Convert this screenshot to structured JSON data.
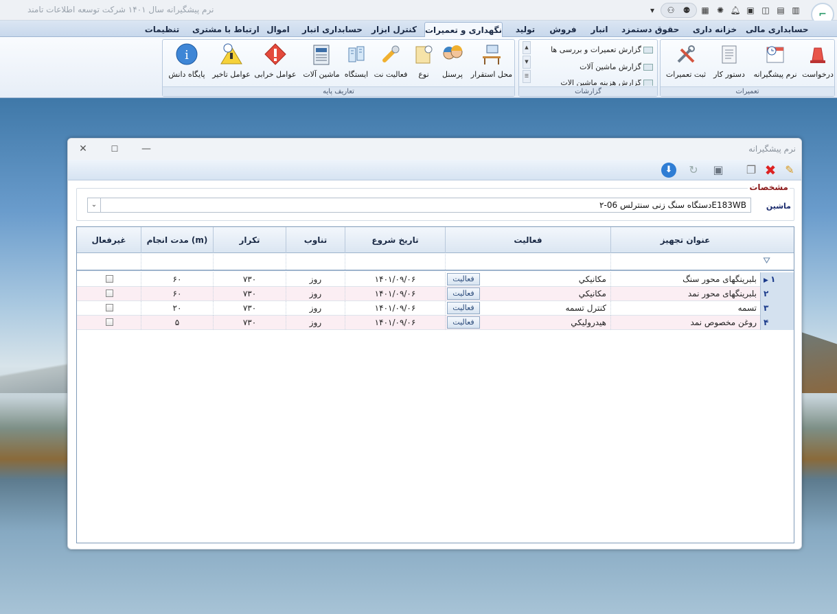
{
  "app": {
    "title": "نرم پیشگیرانه   سال ۱۴۰۱ شرکت توسعه اطلاعات تامند"
  },
  "tabs": [
    "حسابداری مالی",
    "خزانه داری",
    "حقوق دستمزد",
    "انبار",
    "فروش",
    "تولید",
    "نگهداری و تعمیرات",
    "کنترل ابزار",
    "حسابداری انبار",
    "اموال",
    "ارتباط با مشتری",
    "تنظیمات"
  ],
  "ribbon": {
    "groups": {
      "maint": "تعمیرات",
      "reports": "گزارشات",
      "base": "تعاریف پایه"
    },
    "maint_buttons": [
      "درخواست",
      "نرم پیشگیرانه",
      "دستور کار",
      "ثبت تعمیرات"
    ],
    "reports": [
      "گزارش تعمیرات و بررسی ها",
      "گزارش ماشین آلات",
      "گزارش هزینه ماشین آلات"
    ],
    "base_buttons": [
      "محل استقرار",
      "پرسنل",
      "نوع",
      "فعالیت نت",
      "ایستگاه",
      "ماشین آلات",
      "عوامل خرابی",
      "عوامل تاخیر",
      "پایگاه دانش"
    ]
  },
  "window": {
    "title": "نرم پیشگیرانه"
  },
  "form": {
    "legend": "مشخصات",
    "machine_label": "ماشین",
    "machine_value": "دستگاه سنگ زنی سنترلس 06-۲E183WB"
  },
  "grid": {
    "headers": {
      "equip": "عنوان تجهیز",
      "activity": "فعالیت",
      "start": "تاریخ شروع",
      "period": "تناوب",
      "repeat": "تکرار",
      "duration": "مدت انجام (m)",
      "inactive": "غیرفعال"
    },
    "action_label": "فعالیت",
    "rows": [
      {
        "num": "۱",
        "equip": "بلبرینگهای محور سنگ",
        "activity": "مکانیکي",
        "start": "۱۴۰۱/۰۹/۰۶",
        "period": "روز",
        "repeat": "۷۳۰",
        "duration": "۶۰"
      },
      {
        "num": "۲",
        "equip": "بلبرینگهای محور نمد",
        "activity": "مکانیکي",
        "start": "۱۴۰۱/۰۹/۰۶",
        "period": "روز",
        "repeat": "۷۳۰",
        "duration": "۶۰"
      },
      {
        "num": "۳",
        "equip": "تسمه",
        "activity": "کنترل تسمه",
        "start": "۱۴۰۱/۰۹/۰۶",
        "period": "روز",
        "repeat": "۷۳۰",
        "duration": "۲۰"
      },
      {
        "num": "۴",
        "equip": "روغن مخصوص نمد",
        "activity": "هیدرولیکي",
        "start": "۱۴۰۱/۰۹/۰۶",
        "period": "روز",
        "repeat": "۷۳۰",
        "duration": "۵"
      }
    ]
  },
  "colors": {
    "accent": "#1a2a6c",
    "legend": "#8b1a1a",
    "alt_row": "#fbeef3"
  }
}
